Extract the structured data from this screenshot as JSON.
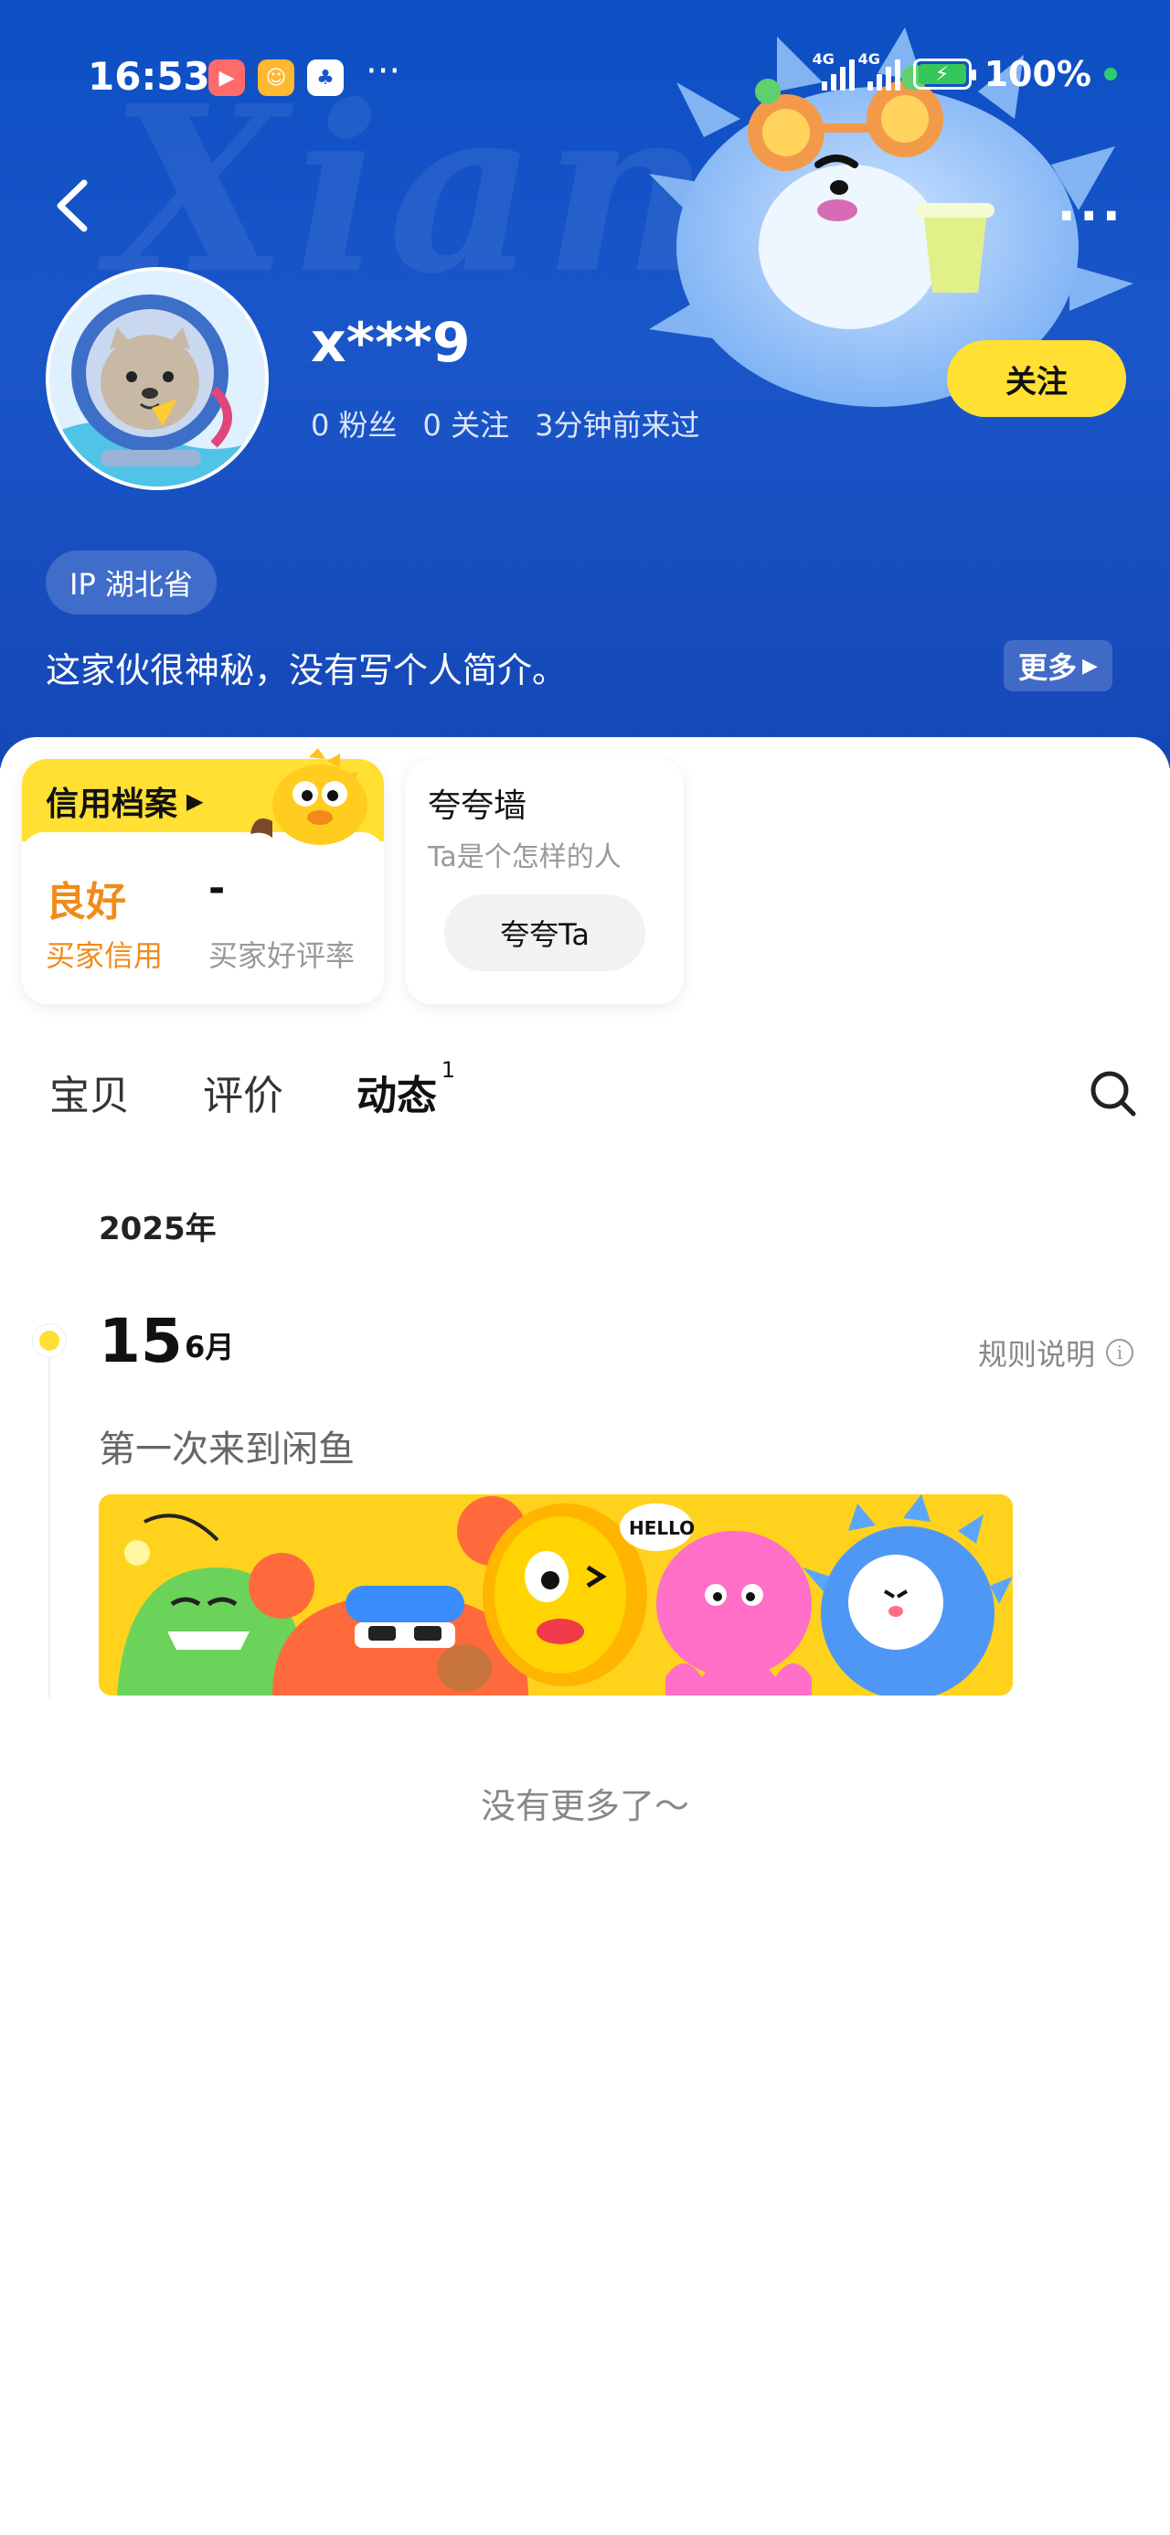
{
  "status_bar": {
    "time": "16:53",
    "more": "···",
    "net1": "4G",
    "net2": "4G",
    "battery": "100%"
  },
  "header": {
    "more_icon": "···",
    "username": "x***9",
    "stats": {
      "fans": "0 粉丝",
      "following": "0 关注",
      "last_seen": "3分钟前来过"
    },
    "follow_label": "关注",
    "ip_label": "IP 湖北省",
    "bio": "这家伙很神秘，没有写个人简介。",
    "more_label": "更多",
    "watermark": "Xianyu"
  },
  "credit_card": {
    "title": "信用档案",
    "value": "良好",
    "label": "买家信用",
    "value2": "-",
    "label2": "买家好评率"
  },
  "praise_card": {
    "title": "夸夸墙",
    "subtitle": "Ta是个怎样的人",
    "button": "夸夸Ta"
  },
  "tabs": [
    {
      "label": "宝贝"
    },
    {
      "label": "评价"
    },
    {
      "label": "动态",
      "badge": "1"
    }
  ],
  "timeline": {
    "year": "2025年",
    "day": "15",
    "month": "6月",
    "rules_label": "规则说明",
    "event": "第一次来到闲鱼",
    "banner_hello": "HELLO"
  },
  "footer": {
    "end_text": "没有更多了～"
  },
  "colors": {
    "brand_blue": "#1a56c9",
    "accent_yellow": "#ffe033",
    "credit_orange": "#f08b1a"
  }
}
